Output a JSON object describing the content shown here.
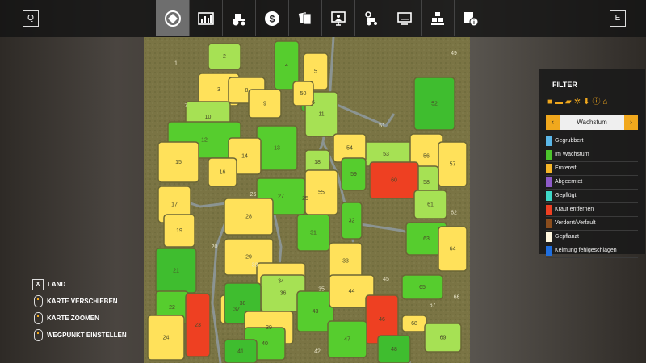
{
  "topbar": {
    "left_key": "Q",
    "right_key": "E",
    "tabs": [
      {
        "name": "tab-map",
        "icon": "map-icon",
        "active": true
      },
      {
        "name": "tab-prices",
        "icon": "chart-icon",
        "active": false
      },
      {
        "name": "tab-vehicles",
        "icon": "tractor-icon",
        "active": false
      },
      {
        "name": "tab-finances",
        "icon": "dollar-icon",
        "active": false
      },
      {
        "name": "tab-contracts",
        "icon": "contracts-icon",
        "active": false
      },
      {
        "name": "tab-help",
        "icon": "presentation-icon",
        "active": false
      },
      {
        "name": "tab-garage",
        "icon": "garage-icon",
        "active": false
      },
      {
        "name": "tab-monitor",
        "icon": "monitor-icon",
        "active": false
      },
      {
        "name": "tab-production",
        "icon": "production-icon",
        "active": false
      },
      {
        "name": "tab-info",
        "icon": "info-icon",
        "active": false
      }
    ]
  },
  "filter": {
    "title": "FILTER",
    "icons": [
      "tractor-icon",
      "trailer-icon",
      "truck-icon",
      "gear-icon",
      "download-icon",
      "alert-icon",
      "home-icon"
    ],
    "dropdown_value": "Wachstum",
    "legend": [
      {
        "label": "Gegrubbert",
        "color": "#5bb7e8"
      },
      {
        "label": "Im Wachstum",
        "color": "#4cc42c"
      },
      {
        "label": "Erntereif",
        "color": "#f5b628"
      },
      {
        "label": "Abgeerntet",
        "color": "#8e5bc8"
      },
      {
        "label": "Gepflügt",
        "color": "#3fd8c7"
      },
      {
        "label": "Kraut entfernen",
        "color": "#ee4022"
      },
      {
        "label": "Verdorrt/Verfault",
        "color": "#8a4d1d"
      },
      {
        "label": "Gepflanzt",
        "color": "#fff7de"
      },
      {
        "label": "Keimung fehlgeschlagen",
        "color": "#1f6fe0"
      }
    ]
  },
  "controls": [
    {
      "type": "key",
      "key": "X",
      "label": "LAND"
    },
    {
      "type": "mouse",
      "label": "KARTE VERSCHIEBEN"
    },
    {
      "type": "mouse",
      "label": "KARTE ZOOMEN"
    },
    {
      "type": "mouse",
      "label": "WEGPUNKT EINSTELLEN"
    }
  ],
  "fields": [
    {
      "id": "1",
      "color": "none"
    },
    {
      "id": "2",
      "color": "#a6e154"
    },
    {
      "id": "3",
      "color": "#ffe15a"
    },
    {
      "id": "4",
      "color": "#56cd2e"
    },
    {
      "id": "5",
      "color": "#ffe15a"
    },
    {
      "id": "6",
      "color": "#3fbd2f"
    },
    {
      "id": "7",
      "color": "none"
    },
    {
      "id": "8",
      "color": "#ffe15a"
    },
    {
      "id": "9",
      "color": "#ffe15a"
    },
    {
      "id": "10",
      "color": "#a6e154"
    },
    {
      "id": "11",
      "color": "#a6e154"
    },
    {
      "id": "12",
      "color": "#56cd2e"
    },
    {
      "id": "13",
      "color": "#56cd2e"
    },
    {
      "id": "14",
      "color": "#ffe15a"
    },
    {
      "id": "15",
      "color": "#ffe15a"
    },
    {
      "id": "16",
      "color": "#ffe15a"
    },
    {
      "id": "17",
      "color": "#ffe15a"
    },
    {
      "id": "18",
      "color": "#a6e154"
    },
    {
      "id": "19",
      "color": "#ffe15a"
    },
    {
      "id": "20",
      "color": "none"
    },
    {
      "id": "21",
      "color": "#3fbd2f"
    },
    {
      "id": "22",
      "color": "#56cd2e"
    },
    {
      "id": "23",
      "color": "#ee4022"
    },
    {
      "id": "24",
      "color": "#ffe15a"
    },
    {
      "id": "25",
      "color": "#a6e154"
    },
    {
      "id": "26",
      "color": "none"
    },
    {
      "id": "27",
      "color": "#56cd2e"
    },
    {
      "id": "28",
      "color": "#ffe15a"
    },
    {
      "id": "29",
      "color": "#ffe15a"
    },
    {
      "id": "30",
      "color": "none"
    },
    {
      "id": "31",
      "color": "#56cd2e"
    },
    {
      "id": "32",
      "color": "#56cd2e"
    },
    {
      "id": "33",
      "color": "#ffe15a"
    },
    {
      "id": "34",
      "color": "#ffe15a"
    },
    {
      "id": "35",
      "color": "none"
    },
    {
      "id": "36",
      "color": "#a6e154"
    },
    {
      "id": "37",
      "color": "#ffe15a"
    },
    {
      "id": "38",
      "color": "#3fbd2f"
    },
    {
      "id": "39",
      "color": "#ffe15a"
    },
    {
      "id": "40",
      "color": "#56cd2e"
    },
    {
      "id": "41",
      "color": "#3fbd2f"
    },
    {
      "id": "42",
      "color": "none"
    },
    {
      "id": "43",
      "color": "#56cd2e"
    },
    {
      "id": "44",
      "color": "#ffe15a"
    },
    {
      "id": "45",
      "color": "none"
    },
    {
      "id": "46",
      "color": "#ee4022"
    },
    {
      "id": "47",
      "color": "#56cd2e"
    },
    {
      "id": "48",
      "color": "#3fbd2f"
    },
    {
      "id": "49",
      "color": "none"
    },
    {
      "id": "50",
      "color": "#ffe15a"
    },
    {
      "id": "51",
      "color": "none"
    },
    {
      "id": "52",
      "color": "#3fbd2f"
    },
    {
      "id": "53",
      "color": "#a6e154"
    },
    {
      "id": "54",
      "color": "#ffe15a"
    },
    {
      "id": "55",
      "color": "#ffe15a"
    },
    {
      "id": "56",
      "color": "#ffe15a"
    },
    {
      "id": "57",
      "color": "#ffe15a"
    },
    {
      "id": "58",
      "color": "#a6e154"
    },
    {
      "id": "59",
      "color": "#56cd2e"
    },
    {
      "id": "60",
      "color": "#ee4022"
    },
    {
      "id": "61",
      "color": "#a6e154"
    },
    {
      "id": "62",
      "color": "none"
    },
    {
      "id": "63",
      "color": "#56cd2e"
    },
    {
      "id": "64",
      "color": "#ffe15a"
    },
    {
      "id": "65",
      "color": "#56cd2e"
    },
    {
      "id": "66",
      "color": "none"
    },
    {
      "id": "67",
      "color": "none"
    },
    {
      "id": "68",
      "color": "#ffe15a"
    },
    {
      "id": "69",
      "color": "#a6e154"
    }
  ]
}
